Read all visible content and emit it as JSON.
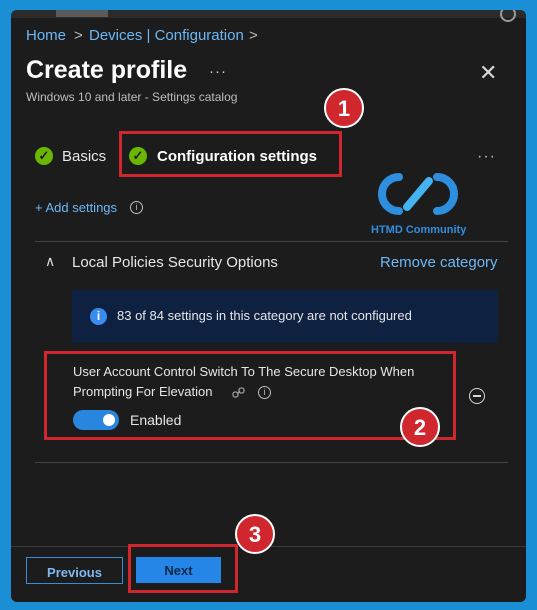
{
  "breadcrumb": {
    "home": "Home",
    "sep1": ">",
    "section": "Devices | Configuration",
    "sep2": ">"
  },
  "header": {
    "title": "Create profile",
    "more": "···",
    "close": "✕",
    "subtitle": "Windows 10 and later - Settings catalog"
  },
  "steps": [
    {
      "label": "Basics",
      "check": "✓"
    },
    {
      "label": "Configuration settings",
      "check": "✓"
    }
  ],
  "steps_more": "···",
  "add_settings": {
    "label": "+ Add settings",
    "info": "i"
  },
  "watermark": {
    "text": "HTMD Community"
  },
  "category": {
    "chevron": "∧",
    "title": "Local Policies Security Options",
    "remove_label": "Remove category"
  },
  "banner": {
    "icon": "i",
    "text": "83 of 84 settings in this category are not configured"
  },
  "setting": {
    "name_line1": "User Account Control Switch To The Secure Desktop When",
    "name_line2": "Prompting For Elevation",
    "toggle_label": "Enabled",
    "toggle_on": true,
    "info": "i"
  },
  "footer": {
    "previous_label": "Previous",
    "next_label": "Next"
  },
  "annotations": [
    "1",
    "2",
    "3"
  ],
  "colors": {
    "accent": "#2586e8",
    "link": "#6cb8f6",
    "success": "#6bb700",
    "highlight": "#d0262e",
    "panel": "#1c1c1c",
    "frame": "#1a8fd6"
  }
}
